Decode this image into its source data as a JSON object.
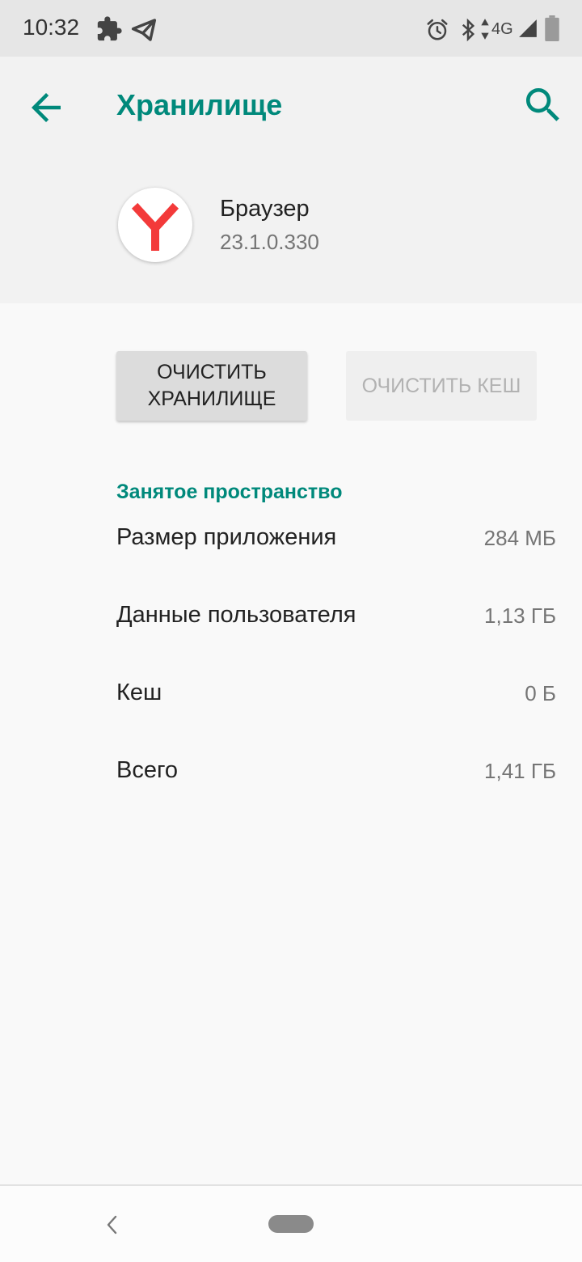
{
  "status_bar": {
    "time": "10:32",
    "network": "4G",
    "icons": [
      "puzzle-icon",
      "telegram-icon",
      "alarm-icon",
      "bluetooth-icon",
      "data-arrows-icon",
      "signal-icon",
      "battery-icon"
    ]
  },
  "header": {
    "title": "Хранилище",
    "back_icon": "arrow-back-icon",
    "search_icon": "search-icon"
  },
  "app": {
    "name": "Браузер",
    "version": "23.1.0.330",
    "icon": "yandex-browser-icon",
    "icon_color": "#f33a3a"
  },
  "buttons": {
    "clear_storage": "ОЧИСТИТЬ ХРАНИЛИЩЕ",
    "clear_cache": "ОЧИСТИТЬ КЕШ",
    "clear_cache_enabled": false
  },
  "storage": {
    "section_title": "Занятое пространство",
    "rows": [
      {
        "label": "Размер приложения",
        "value": "284 МБ"
      },
      {
        "label": "Данные пользователя",
        "value": "1,13 ГБ"
      },
      {
        "label": "Кеш",
        "value": "0 Б"
      },
      {
        "label": "Всего",
        "value": "1,41 ГБ"
      }
    ]
  },
  "colors": {
    "accent": "#00897b",
    "status_bar_bg": "#e6e6e6",
    "header_bg": "#f2f2f2",
    "page_bg": "#f9f9f9"
  }
}
